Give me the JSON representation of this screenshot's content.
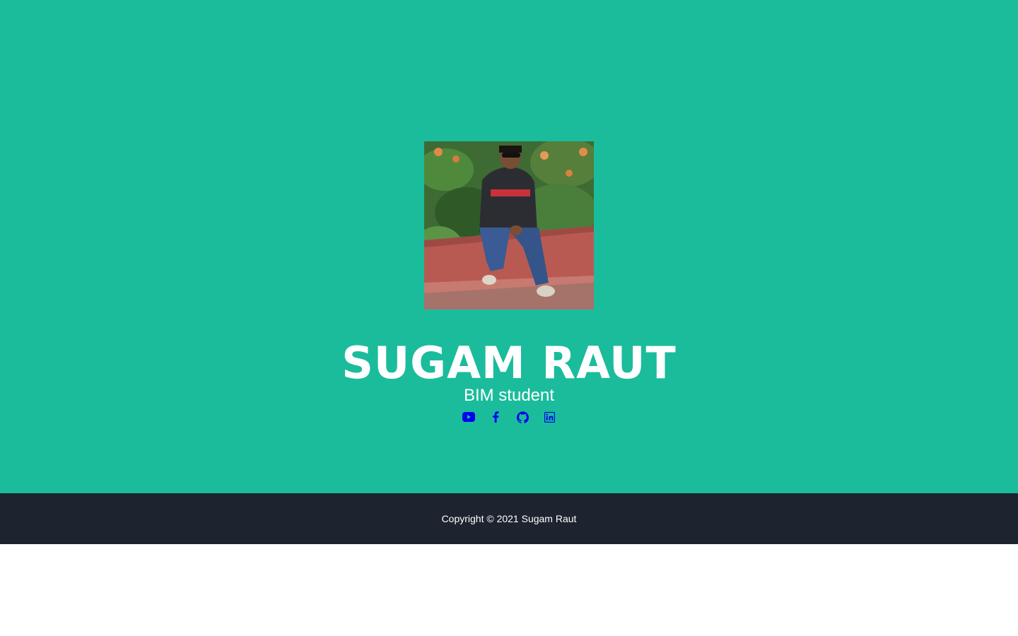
{
  "profile": {
    "name": "SUGAM RAUT",
    "role": "BIM student",
    "photo_alt": "Sugam Raut"
  },
  "socials": [
    {
      "icon": "youtube-icon"
    },
    {
      "icon": "facebook-icon"
    },
    {
      "icon": "github-icon"
    },
    {
      "icon": "linkedin-icon"
    }
  ],
  "footer": {
    "copyright": "Copyright © 2021 Sugam Raut"
  },
  "colors": {
    "hero_bg": "#1abc9c",
    "footer_bg": "#1d2430",
    "link": "#0000ee",
    "text": "#ffffff"
  }
}
